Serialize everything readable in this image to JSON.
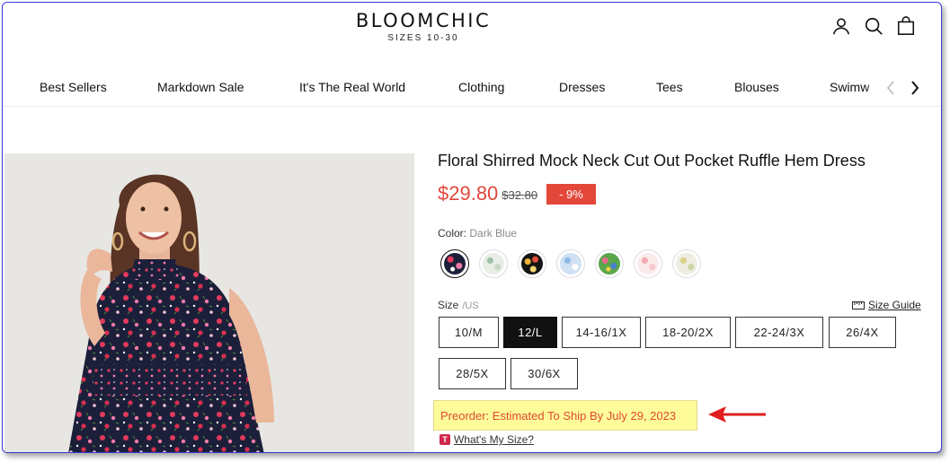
{
  "header": {
    "brand": "BLOOMCHIC",
    "tagline": "SIZES 10-30",
    "icons": [
      "account-icon",
      "search-icon",
      "bag-icon"
    ]
  },
  "nav": {
    "items": [
      "Best Sellers",
      "Markdown Sale",
      "It's The Real World",
      "Clothing",
      "Dresses",
      "Tees",
      "Blouses",
      "Swimwear"
    ]
  },
  "product": {
    "title": "Floral Shirred Mock Neck Cut Out Pocket Ruffle Hem Dress",
    "price": "$29.80",
    "original_price": "$32.80",
    "discount": "- 9%",
    "color_label": "Color:",
    "color_value": "Dark Blue",
    "swatches": [
      "Dark Blue",
      "Mint Floral",
      "Black Floral",
      "Light Blue",
      "Green Floral",
      "Pink Floral",
      "Beige Floral"
    ],
    "size_label": "Size",
    "size_unit": "/US",
    "size_guide": "Size Guide",
    "sizes": [
      "10/M",
      "12/L",
      "14-16/1X",
      "18-20/2X",
      "22-24/3X",
      "26/4X",
      "28/5X",
      "30/6X"
    ],
    "selected_size": "12/L",
    "preorder": "Preorder: Estimated To Ship By July 29, 2023",
    "whats_my_size": "What's My Size?",
    "whats_badge": "T"
  },
  "colors": {
    "price_red": "#e2473a",
    "annotation_red": "#e11d1d",
    "highlight_yellow": "#fdfb9a",
    "frame_blue": "#3b3bd6"
  }
}
